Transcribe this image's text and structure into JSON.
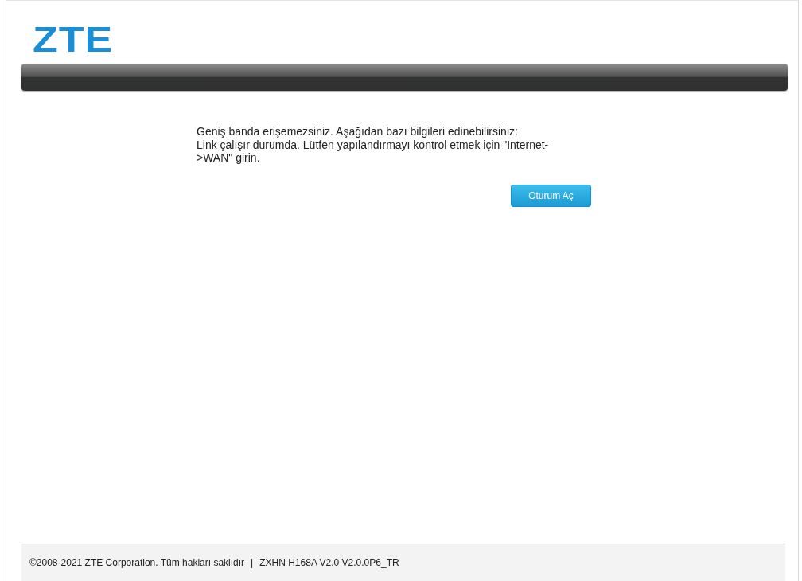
{
  "logo": "ZTE",
  "message": {
    "lines": [
      "Geniş banda erişemezsiniz. Aşağıdan bazı bilgileri edinebilirsiniz:",
      "Link çalışır durumda. Lütfen yapılandırmayı kontrol etmek için \"Internet->WAN\" girin."
    ]
  },
  "buttons": [
    "Oturum Aç"
  ],
  "footer": {
    "copyright": "©2008-2021 ZTE Corporation. Tüm hakları saklıdır",
    "separator": "|",
    "version": "ZXHN H168A V2.0 V2.0.0P6_TR"
  }
}
